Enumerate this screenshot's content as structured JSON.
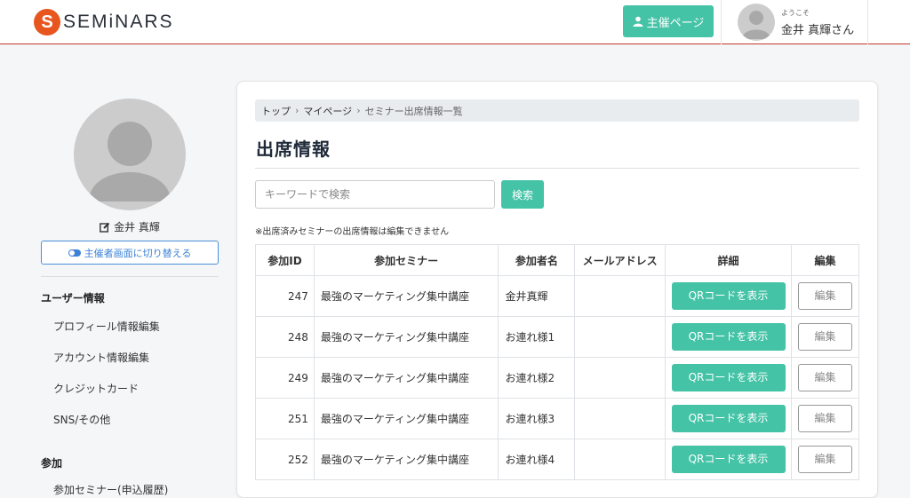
{
  "header": {
    "logo_letter": "S",
    "logo_text": "SEMiNARS",
    "organizer_button": "主催ページ",
    "welcome": "ようこそ",
    "user_name": "金井 真輝さん"
  },
  "sidebar": {
    "name": "金井 真輝",
    "switch_button": "主催者画面に切り替える",
    "sections": [
      {
        "heading": "ユーザー情報",
        "items": [
          "プロフィール情報編集",
          "アカウント情報編集",
          "クレジットカード",
          "SNS/その他"
        ]
      },
      {
        "heading": "参加",
        "items": [
          "参加セミナー(申込履歴)"
        ]
      }
    ]
  },
  "main": {
    "breadcrumb": [
      "トップ",
      "マイページ",
      "セミナー出席情報一覧"
    ],
    "title": "出席情報",
    "search": {
      "placeholder": "キーワードで検索",
      "value": "",
      "button": "検索"
    },
    "notice": "※出席済みセミナーの出席情報は編集できません",
    "table": {
      "headers": [
        "参加ID",
        "参加セミナー",
        "参加者名",
        "メールアドレス",
        "詳細",
        "編集"
      ],
      "rows": [
        {
          "id": "247",
          "seminar": "最強のマーケティング集中講座",
          "participant": "金井真輝",
          "email": "",
          "detail": "QRコードを表示",
          "edit": "編集"
        },
        {
          "id": "248",
          "seminar": "最強のマーケティング集中講座",
          "participant": "お連れ様1",
          "email": "",
          "detail": "QRコードを表示",
          "edit": "編集"
        },
        {
          "id": "249",
          "seminar": "最強のマーケティング集中講座",
          "participant": "お連れ様2",
          "email": "",
          "detail": "QRコードを表示",
          "edit": "編集"
        },
        {
          "id": "251",
          "seminar": "最強のマーケティング集中講座",
          "participant": "お連れ様3",
          "email": "",
          "detail": "QRコードを表示",
          "edit": "編集"
        },
        {
          "id": "252",
          "seminar": "最強のマーケティング集中講座",
          "participant": "お連れ様4",
          "email": "",
          "detail": "QRコードを表示",
          "edit": "編集"
        }
      ]
    }
  },
  "colors": {
    "accent": "#44c3a6",
    "brand": "#e8561f",
    "link": "#3b82d6",
    "header_rule": "#c0392b"
  },
  "icons": {
    "organizer": "user-icon",
    "edit_name": "edit-icon",
    "switch": "toggle-icon"
  }
}
